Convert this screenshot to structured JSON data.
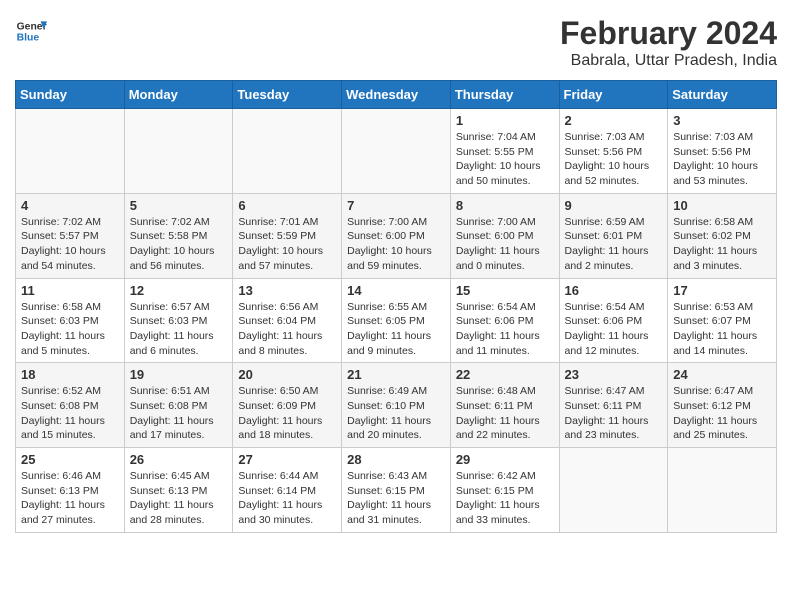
{
  "header": {
    "logo_line1": "General",
    "logo_line2": "Blue",
    "month_year": "February 2024",
    "location": "Babrala, Uttar Pradesh, India"
  },
  "weekdays": [
    "Sunday",
    "Monday",
    "Tuesday",
    "Wednesday",
    "Thursday",
    "Friday",
    "Saturday"
  ],
  "weeks": [
    [
      {
        "day": "",
        "info": ""
      },
      {
        "day": "",
        "info": ""
      },
      {
        "day": "",
        "info": ""
      },
      {
        "day": "",
        "info": ""
      },
      {
        "day": "1",
        "info": "Sunrise: 7:04 AM\nSunset: 5:55 PM\nDaylight: 10 hours\nand 50 minutes."
      },
      {
        "day": "2",
        "info": "Sunrise: 7:03 AM\nSunset: 5:56 PM\nDaylight: 10 hours\nand 52 minutes."
      },
      {
        "day": "3",
        "info": "Sunrise: 7:03 AM\nSunset: 5:56 PM\nDaylight: 10 hours\nand 53 minutes."
      }
    ],
    [
      {
        "day": "4",
        "info": "Sunrise: 7:02 AM\nSunset: 5:57 PM\nDaylight: 10 hours\nand 54 minutes."
      },
      {
        "day": "5",
        "info": "Sunrise: 7:02 AM\nSunset: 5:58 PM\nDaylight: 10 hours\nand 56 minutes."
      },
      {
        "day": "6",
        "info": "Sunrise: 7:01 AM\nSunset: 5:59 PM\nDaylight: 10 hours\nand 57 minutes."
      },
      {
        "day": "7",
        "info": "Sunrise: 7:00 AM\nSunset: 6:00 PM\nDaylight: 10 hours\nand 59 minutes."
      },
      {
        "day": "8",
        "info": "Sunrise: 7:00 AM\nSunset: 6:00 PM\nDaylight: 11 hours\nand 0 minutes."
      },
      {
        "day": "9",
        "info": "Sunrise: 6:59 AM\nSunset: 6:01 PM\nDaylight: 11 hours\nand 2 minutes."
      },
      {
        "day": "10",
        "info": "Sunrise: 6:58 AM\nSunset: 6:02 PM\nDaylight: 11 hours\nand 3 minutes."
      }
    ],
    [
      {
        "day": "11",
        "info": "Sunrise: 6:58 AM\nSunset: 6:03 PM\nDaylight: 11 hours\nand 5 minutes."
      },
      {
        "day": "12",
        "info": "Sunrise: 6:57 AM\nSunset: 6:03 PM\nDaylight: 11 hours\nand 6 minutes."
      },
      {
        "day": "13",
        "info": "Sunrise: 6:56 AM\nSunset: 6:04 PM\nDaylight: 11 hours\nand 8 minutes."
      },
      {
        "day": "14",
        "info": "Sunrise: 6:55 AM\nSunset: 6:05 PM\nDaylight: 11 hours\nand 9 minutes."
      },
      {
        "day": "15",
        "info": "Sunrise: 6:54 AM\nSunset: 6:06 PM\nDaylight: 11 hours\nand 11 minutes."
      },
      {
        "day": "16",
        "info": "Sunrise: 6:54 AM\nSunset: 6:06 PM\nDaylight: 11 hours\nand 12 minutes."
      },
      {
        "day": "17",
        "info": "Sunrise: 6:53 AM\nSunset: 6:07 PM\nDaylight: 11 hours\nand 14 minutes."
      }
    ],
    [
      {
        "day": "18",
        "info": "Sunrise: 6:52 AM\nSunset: 6:08 PM\nDaylight: 11 hours\nand 15 minutes."
      },
      {
        "day": "19",
        "info": "Sunrise: 6:51 AM\nSunset: 6:08 PM\nDaylight: 11 hours\nand 17 minutes."
      },
      {
        "day": "20",
        "info": "Sunrise: 6:50 AM\nSunset: 6:09 PM\nDaylight: 11 hours\nand 18 minutes."
      },
      {
        "day": "21",
        "info": "Sunrise: 6:49 AM\nSunset: 6:10 PM\nDaylight: 11 hours\nand 20 minutes."
      },
      {
        "day": "22",
        "info": "Sunrise: 6:48 AM\nSunset: 6:11 PM\nDaylight: 11 hours\nand 22 minutes."
      },
      {
        "day": "23",
        "info": "Sunrise: 6:47 AM\nSunset: 6:11 PM\nDaylight: 11 hours\nand 23 minutes."
      },
      {
        "day": "24",
        "info": "Sunrise: 6:47 AM\nSunset: 6:12 PM\nDaylight: 11 hours\nand 25 minutes."
      }
    ],
    [
      {
        "day": "25",
        "info": "Sunrise: 6:46 AM\nSunset: 6:13 PM\nDaylight: 11 hours\nand 27 minutes."
      },
      {
        "day": "26",
        "info": "Sunrise: 6:45 AM\nSunset: 6:13 PM\nDaylight: 11 hours\nand 28 minutes."
      },
      {
        "day": "27",
        "info": "Sunrise: 6:44 AM\nSunset: 6:14 PM\nDaylight: 11 hours\nand 30 minutes."
      },
      {
        "day": "28",
        "info": "Sunrise: 6:43 AM\nSunset: 6:15 PM\nDaylight: 11 hours\nand 31 minutes."
      },
      {
        "day": "29",
        "info": "Sunrise: 6:42 AM\nSunset: 6:15 PM\nDaylight: 11 hours\nand 33 minutes."
      },
      {
        "day": "",
        "info": ""
      },
      {
        "day": "",
        "info": ""
      }
    ]
  ]
}
